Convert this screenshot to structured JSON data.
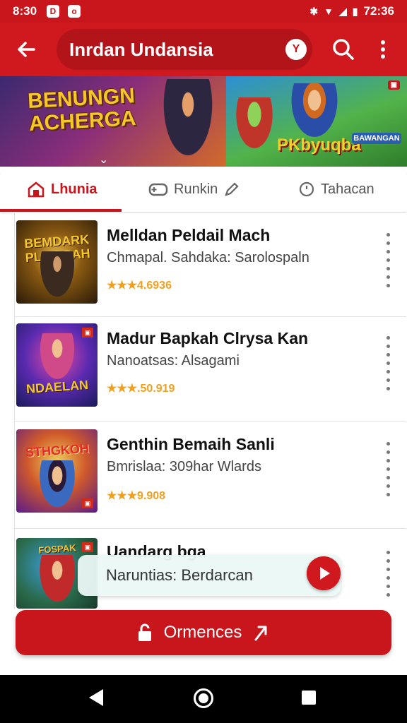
{
  "status_bar": {
    "time": "8:30",
    "icon1": "D",
    "icon2": "o",
    "signal_text": "72:36"
  },
  "app_bar": {
    "title": "Inrdan Undansia",
    "badge": "Y"
  },
  "banner": {
    "left_title": "BENUNGN ACHERGA",
    "left_subtitle": "",
    "right_title": "PKbyuqba",
    "right_subtitle": "BAWANGAN"
  },
  "tabs": [
    {
      "label": "Lhunia",
      "active": true
    },
    {
      "label": "Runkin",
      "active": false
    },
    {
      "label": "Tahacan",
      "active": false
    }
  ],
  "items": [
    {
      "thumb_text": "BEMDARK PLMOGAH",
      "name": "Melldan Peldail Mach",
      "subtitle": "Chmapal. Sahdaka: Sarolospaln",
      "rating_text": "★★★4.6936"
    },
    {
      "thumb_text": "NDAELAN",
      "name": "Madur Bapkah Clrysa Kan",
      "subtitle": "Nanoatsas: Alsagami",
      "rating_text": "★★★.50.919"
    },
    {
      "thumb_text": "STHGKOH",
      "name": "Genthin Bemaih Sanli",
      "subtitle": "Bmrislaa: 309har Wlards",
      "rating_text": "★★★9.908"
    },
    {
      "thumb_text": "FOSPAK",
      "name": "Uandarg bga",
      "subtitle": "",
      "rating_text": ""
    }
  ],
  "now_playing": {
    "text": "Naruntias: Berdarcan"
  },
  "cta": {
    "label": "Ormences"
  },
  "colors": {
    "primary_red": "#c9161d",
    "star_orange": "#f0a020"
  }
}
